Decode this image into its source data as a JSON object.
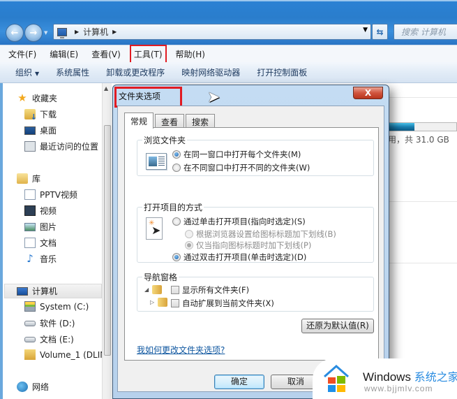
{
  "explorer": {
    "address": {
      "path_segment": "计算机"
    },
    "search_placeholder": "搜索 计算机",
    "menu": [
      {
        "label": "文件(F)"
      },
      {
        "label": "编辑(E)"
      },
      {
        "label": "查看(V)"
      },
      {
        "label": "工具(T)",
        "highlighted": true
      },
      {
        "label": "帮助(H)"
      }
    ],
    "commands": [
      {
        "label": "组织"
      },
      {
        "label": "系统属性"
      },
      {
        "label": "卸载或更改程序"
      },
      {
        "label": "映射网络驱动器"
      },
      {
        "label": "打开控制面板"
      }
    ],
    "sidebar": {
      "favorites": {
        "label": "收藏夹",
        "items": [
          {
            "label": "下载"
          },
          {
            "label": "桌面"
          },
          {
            "label": "最近访问的位置"
          }
        ]
      },
      "libraries": {
        "label": "库",
        "items": [
          {
            "label": "PPTV视频"
          },
          {
            "label": "视频"
          },
          {
            "label": "图片"
          },
          {
            "label": "文档"
          },
          {
            "label": "音乐"
          }
        ]
      },
      "computer": {
        "label": "计算机",
        "items": [
          {
            "label": "System (C:)"
          },
          {
            "label": "软件 (D:)"
          },
          {
            "label": "文档 (E:)"
          },
          {
            "label": "Volume_1 (DLIN"
          }
        ]
      },
      "network": {
        "label": "网络"
      }
    },
    "content": {
      "drive_info_partial": "用，共 31.0 GB",
      "drive_usage_fraction": 0.38
    }
  },
  "dialog": {
    "title": "文件夹选项",
    "close_label": "X",
    "tabs": [
      {
        "label": "常规",
        "active": true
      },
      {
        "label": "查看"
      },
      {
        "label": "搜索"
      }
    ],
    "browse": {
      "label": "浏览文件夹",
      "options": [
        {
          "label": "在同一窗口中打开每个文件夹(M)",
          "checked": true
        },
        {
          "label": "在不同窗口中打开不同的文件夹(W)",
          "checked": false
        }
      ]
    },
    "click": {
      "label": "打开项目的方式",
      "single": {
        "label": "通过单击打开项目(指向时选定)(S)",
        "checked": false
      },
      "sub_options": [
        {
          "label": "根据浏览器设置给图标标题加下划线(B)",
          "checked": false
        },
        {
          "label": "仅当指向图标标题时加下划线(P)",
          "checked": true
        }
      ],
      "double": {
        "label": "通过双击打开项目(单击时选定)(D)",
        "checked": true
      }
    },
    "nav_pane": {
      "label": "导航窗格",
      "options": [
        {
          "label": "显示所有文件夹(F)",
          "checked": false
        },
        {
          "label": "自动扩展到当前文件夹(X)",
          "checked": false
        }
      ]
    },
    "restore_label": "还原为默认值(R)",
    "help_link": "我如何更改文件夹选项?",
    "ok_label": "确定",
    "cancel_label": "取消"
  },
  "watermark": {
    "brand": "Windows",
    "brand_cn": "系统之家",
    "url": "www.bjjmlv.com"
  },
  "colors": {
    "highlight_red": "#e11b22",
    "link_blue": "#0f57a0",
    "title_glass": "#2a7dcc"
  }
}
